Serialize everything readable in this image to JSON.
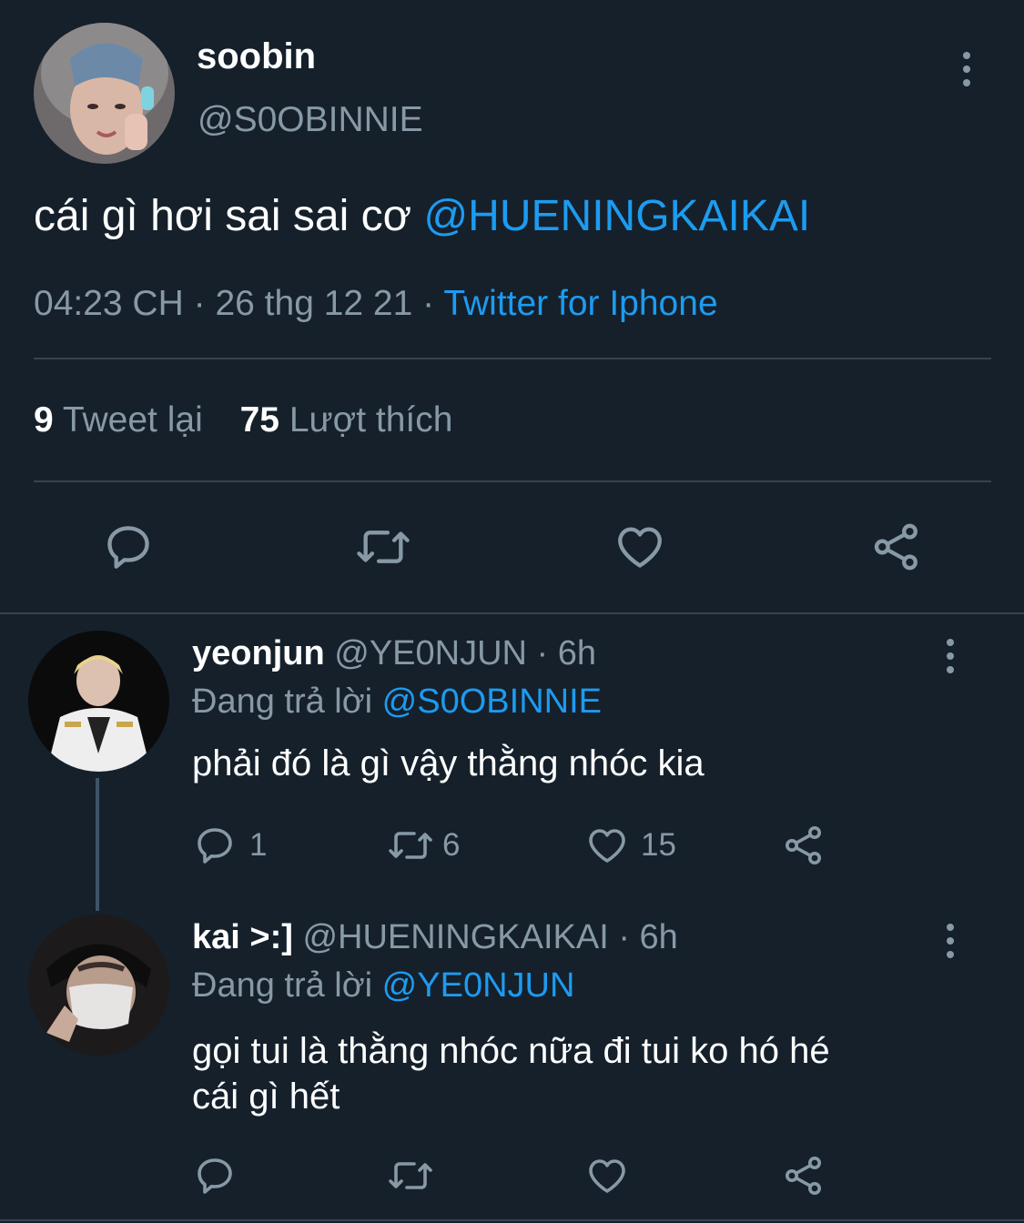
{
  "main_tweet": {
    "display_name": "soobin",
    "handle": "@S0OBINNIE",
    "text": "cái gì hơi sai sai cơ",
    "mention": "@HUENINGKAIKAI",
    "time": "04:23 CH",
    "sep1": "·",
    "date": "26 thg 12 21",
    "sep2": "·",
    "source": "Twitter for Iphone",
    "retweets_count": "9",
    "retweets_label": "Tweet lại",
    "likes_count": "75",
    "likes_label": "Lượt thích"
  },
  "replies": [
    {
      "display_name": "yeonjun",
      "handle": "@YE0NJUN",
      "time": "· 6h",
      "replying_label": "Đang trả lời",
      "replying_to": "@S0OBINNIE",
      "text_line1": "phải đó là gì vậy thằng nhóc kia",
      "text_line2": "",
      "reply_count": "1",
      "retweet_count": "6",
      "like_count": "15"
    },
    {
      "display_name": "kai >:]",
      "handle": "@HUENINGKAIKAI",
      "time": "· 6h",
      "replying_label": "Đang trả lời",
      "replying_to": "@YE0NJUN",
      "text_line1": "gọi tui là thằng nhóc nữa đi tui ko hó hé",
      "text_line2": "cái gì hết",
      "reply_count": "",
      "retweet_count": "",
      "like_count": ""
    }
  ],
  "colors": {
    "background": "#15202b",
    "text": "#ffffff",
    "muted": "#8899a6",
    "accent": "#1d9bf0",
    "divider": "#38444d"
  },
  "icons": [
    "reply-icon",
    "retweet-icon",
    "like-icon",
    "share-icon",
    "more-icon"
  ]
}
